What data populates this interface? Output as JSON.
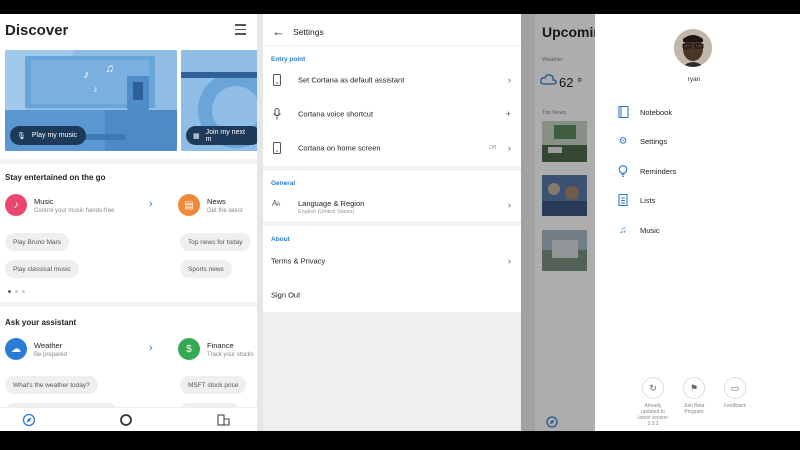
{
  "discover": {
    "title": "Discover",
    "cards": [
      {
        "label": "Play my music"
      },
      {
        "label": "Join my next m"
      }
    ],
    "section1": {
      "title": "Stay entertained on the go",
      "skills": [
        {
          "name": "Music",
          "desc": "Control your music hands-free",
          "icon": "music-note-icon",
          "color": "#e8476e"
        },
        {
          "name": "News",
          "desc": "Get the latest",
          "icon": "news-icon",
          "color": "#f0883a"
        }
      ],
      "chips_left": [
        "Play Bruno Mars",
        "Play classical music"
      ],
      "chips_right": [
        "Top news for today",
        "Sports news"
      ]
    },
    "section2": {
      "title": "Ask your assistant",
      "skills": [
        {
          "name": "Weather",
          "desc": "Be prepared",
          "icon": "weather-cloud-icon",
          "color": "#2b7cd3"
        },
        {
          "name": "Finance",
          "desc": "Track your stocks",
          "icon": "finance-icon",
          "color": "#35a853"
        }
      ],
      "chips_left": [
        "What's the weather today?"
      ],
      "chips_right": [
        "MSFT stock price"
      ]
    }
  },
  "settings": {
    "title": "Settings",
    "groups": [
      {
        "header": "Entry point",
        "items": [
          {
            "label": "Set Cortana as default assistant",
            "icon": "phone-icon",
            "right": "chevron"
          },
          {
            "label": "Cortana voice shortcut",
            "icon": "microphone-icon",
            "right": "plus"
          },
          {
            "label": "Cortana on home screen",
            "icon": "phone-icon",
            "value": "Off",
            "right": "chevron"
          }
        ]
      },
      {
        "header": "General",
        "items": [
          {
            "label": "Language & Region",
            "sub": "English (United States)",
            "icon": "language-icon",
            "right": "chevron"
          }
        ]
      },
      {
        "header": "About",
        "items": [
          {
            "label": "Terms & Privacy",
            "right": "chevron"
          },
          {
            "label": "Sign Out"
          }
        ]
      }
    ]
  },
  "upcoming": {
    "title": "Upcoming",
    "weather_label": "Weather",
    "temp": "62 °",
    "top_news_label": "Top News"
  },
  "menu": {
    "username": "ryan",
    "items": [
      {
        "label": "Notebook",
        "icon": "notebook-icon"
      },
      {
        "label": "Settings",
        "icon": "gear-icon"
      },
      {
        "label": "Reminders",
        "icon": "lightbulb-icon"
      },
      {
        "label": "Lists",
        "icon": "list-icon"
      },
      {
        "label": "Music",
        "icon": "music-note-icon"
      }
    ],
    "footer": [
      {
        "label": "Already updated to latest version 3.3.3",
        "icon": "refresh-icon"
      },
      {
        "label": "Join Beta Program",
        "icon": "flag-icon"
      },
      {
        "label": "Feedback",
        "icon": "feedback-icon"
      }
    ]
  },
  "accent": "#2b7cd3"
}
